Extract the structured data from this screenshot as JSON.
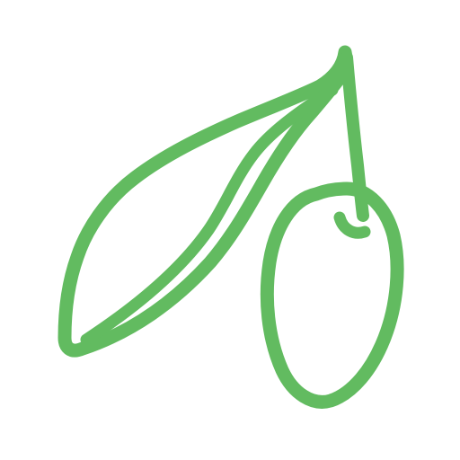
{
  "icon": {
    "name": "olive-branch-icon",
    "stroke_color": "#62bb60",
    "background_color": "#ffffff"
  }
}
